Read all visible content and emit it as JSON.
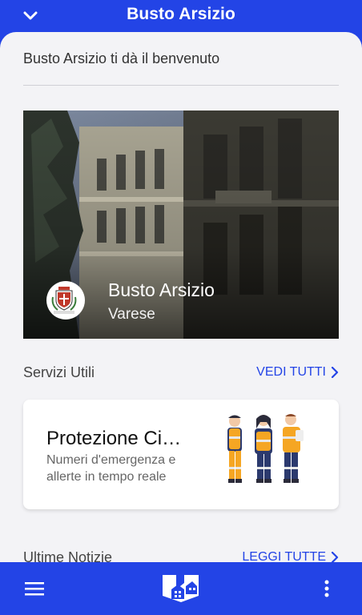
{
  "header": {
    "title": "Busto Arsizio"
  },
  "welcome": "Busto Arsizio ti dà il benvenuto",
  "hero": {
    "city": "Busto Arsizio",
    "province": "Varese"
  },
  "services": {
    "title": "Servizi Utili",
    "link": "VEDI TUTTI",
    "card": {
      "title": "Protezione Ci…",
      "description": "Numeri d'emergenza e allerte in tempo reale"
    }
  },
  "news": {
    "title": "Ultime Notizie",
    "link": "LEGGI TUTTE"
  },
  "colors": {
    "accent": "#2344e6",
    "background": "#f3f3f6"
  },
  "icons": {
    "back": "chevron-down-icon",
    "menu": "hamburger-menu-icon",
    "more": "more-vertical-icon",
    "logo": "app-logo-icon",
    "link": "chevron-right-icon"
  }
}
